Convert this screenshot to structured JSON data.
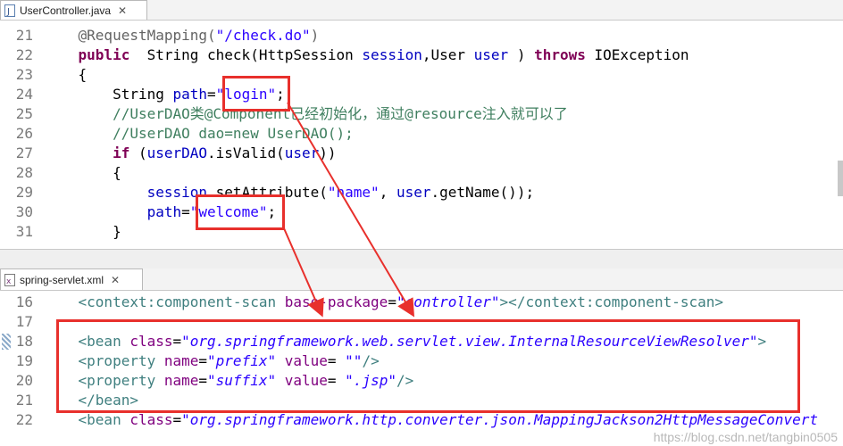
{
  "top_editor": {
    "tab": {
      "label": "UserController.java",
      "close": "✕"
    },
    "lines": [
      {
        "n": "21",
        "parts": [
          [
            "ann",
            "    @RequestMapping("
          ],
          [
            "str",
            "\"/check.do\""
          ],
          [
            "ann",
            ")"
          ]
        ]
      },
      {
        "n": "22",
        "parts": [
          [
            "kw",
            "    public"
          ],
          [
            "",
            "  String check(HttpSession "
          ],
          [
            "var",
            "session"
          ],
          [
            "",
            ",User "
          ],
          [
            "var",
            "user"
          ],
          [
            "",
            " ) "
          ],
          [
            "kw",
            "throws"
          ],
          [
            "",
            " IOException"
          ]
        ]
      },
      {
        "n": "23",
        "parts": [
          [
            "",
            "    {"
          ]
        ]
      },
      {
        "n": "24",
        "parts": [
          [
            "",
            "        String "
          ],
          [
            "var",
            "path"
          ],
          [
            "",
            "="
          ],
          [
            "str",
            "\"login\""
          ],
          [
            "",
            ";"
          ]
        ]
      },
      {
        "n": "25",
        "parts": [
          [
            "cmt",
            "        //UserDAO类@Component已经初始化，通过@resource注入就可以了"
          ]
        ]
      },
      {
        "n": "26",
        "parts": [
          [
            "cmt",
            "        //UserDAO dao=new UserDAO();"
          ]
        ]
      },
      {
        "n": "27",
        "parts": [
          [
            "kw",
            "        if"
          ],
          [
            "",
            " ("
          ],
          [
            "var",
            "userDAO"
          ],
          [
            "",
            ".isValid("
          ],
          [
            "var",
            "user"
          ],
          [
            "",
            "))"
          ]
        ]
      },
      {
        "n": "28",
        "parts": [
          [
            "",
            "        {"
          ]
        ]
      },
      {
        "n": "29",
        "parts": [
          [
            "var",
            "            session"
          ],
          [
            "",
            ".setAttribute("
          ],
          [
            "str",
            "\"name\""
          ],
          [
            "",
            ", "
          ],
          [
            "var",
            "user"
          ],
          [
            "",
            ".getName());"
          ]
        ]
      },
      {
        "n": "30",
        "parts": [
          [
            "var",
            "            path"
          ],
          [
            "",
            "="
          ],
          [
            "str",
            "\"welcome\""
          ],
          [
            "",
            ";"
          ]
        ]
      },
      {
        "n": "31",
        "parts": [
          [
            "",
            "        }"
          ]
        ]
      }
    ]
  },
  "bottom_editor": {
    "tab": {
      "label": "spring-servlet.xml",
      "close": "✕"
    },
    "lines": [
      {
        "n": "16",
        "parts": [
          [
            "tag",
            "    <context:component-scan "
          ],
          [
            "attr",
            "base-package"
          ],
          [
            "",
            "="
          ],
          [
            "val",
            "\"controller\""
          ],
          [
            "tag",
            "></context:component-scan>"
          ]
        ]
      },
      {
        "n": "17",
        "parts": []
      },
      {
        "n": "18",
        "parts": [
          [
            "tag",
            "    <bean "
          ],
          [
            "attr",
            "class"
          ],
          [
            "",
            "="
          ],
          [
            "val",
            "\"org.springframework.web.servlet.view.InternalResourceViewResolver\""
          ],
          [
            "tag",
            ">"
          ]
        ]
      },
      {
        "n": "19",
        "parts": [
          [
            "tag",
            "    <property "
          ],
          [
            "attr",
            "name"
          ],
          [
            "",
            "="
          ],
          [
            "val",
            "\"prefix\""
          ],
          [
            "",
            " "
          ],
          [
            "attr",
            "value"
          ],
          [
            "",
            "= "
          ],
          [
            "val",
            "\"\""
          ],
          [
            "tag",
            "/>"
          ]
        ]
      },
      {
        "n": "20",
        "parts": [
          [
            "tag",
            "    <property "
          ],
          [
            "attr",
            "name"
          ],
          [
            "",
            "="
          ],
          [
            "val",
            "\"suffix\""
          ],
          [
            "",
            " "
          ],
          [
            "attr",
            "value"
          ],
          [
            "",
            "= "
          ],
          [
            "val",
            "\".jsp\""
          ],
          [
            "tag",
            "/>"
          ]
        ]
      },
      {
        "n": "21",
        "parts": [
          [
            "tag",
            "    </bean>"
          ]
        ]
      },
      {
        "n": "22",
        "parts": [
          [
            "tag",
            "    <bean "
          ],
          [
            "attr",
            "class"
          ],
          [
            "",
            "="
          ],
          [
            "val",
            "\"org.springframework.http.converter.json.MappingJackson2HttpMessageConvert"
          ]
        ]
      }
    ]
  },
  "watermark": "https://blog.csdn.net/tangbin0505"
}
